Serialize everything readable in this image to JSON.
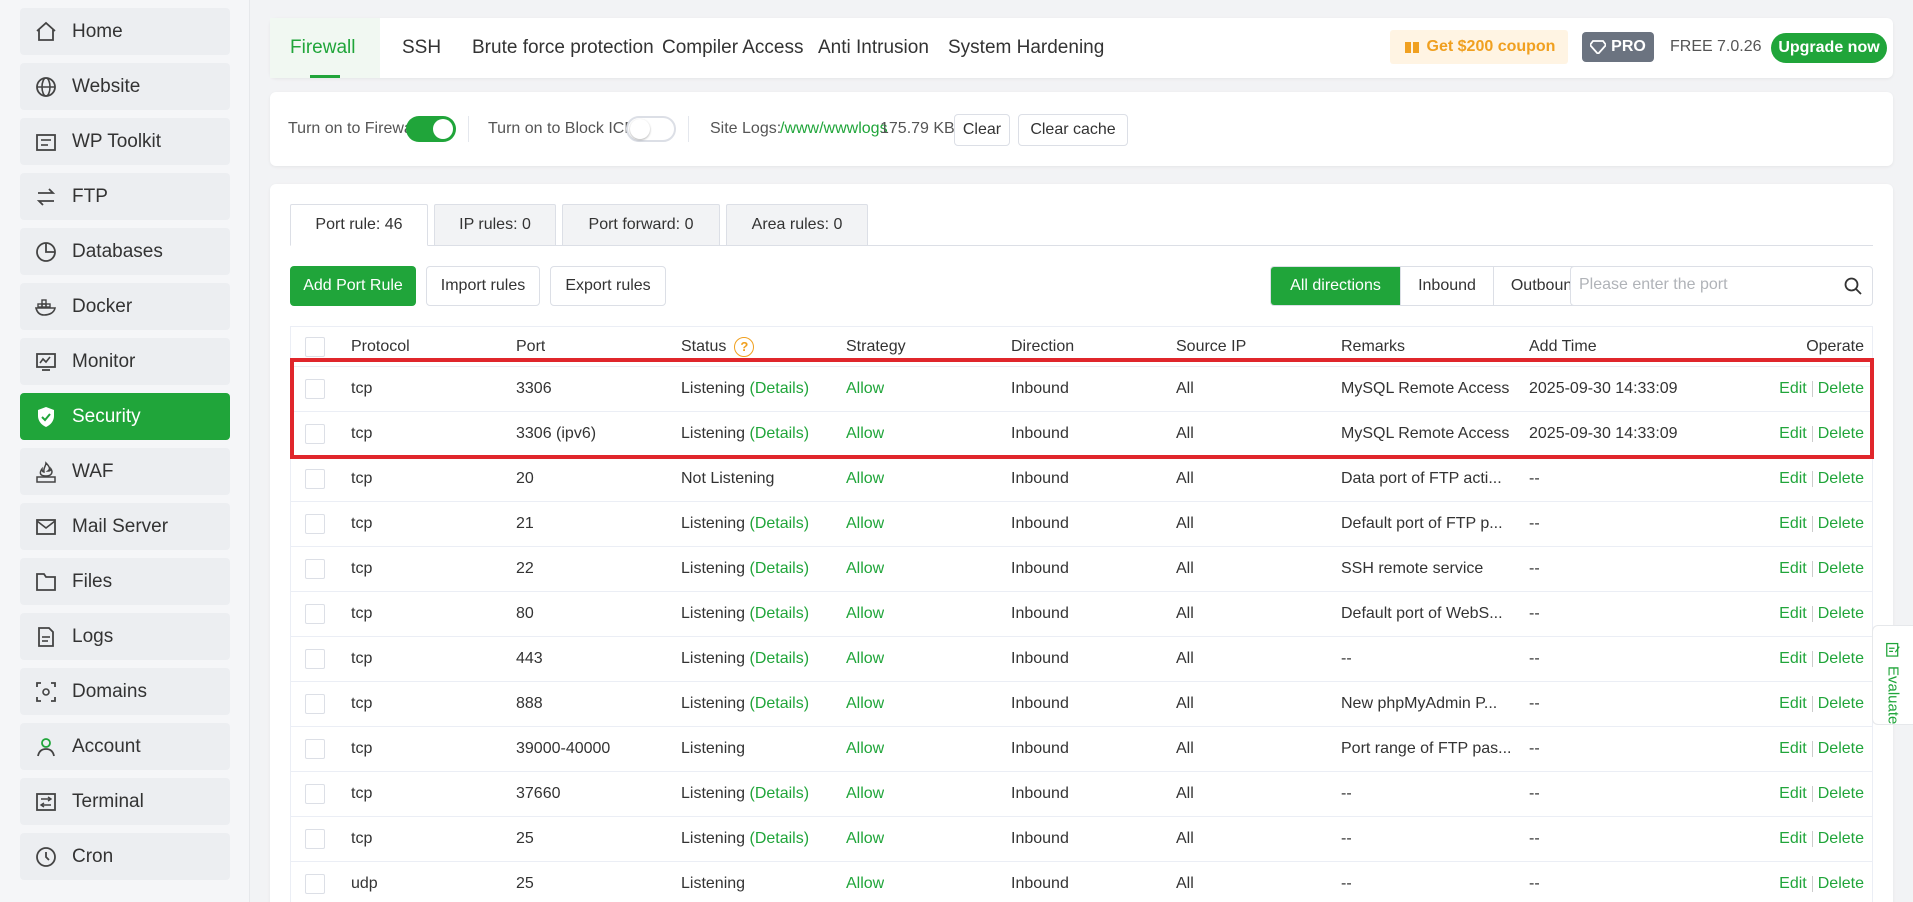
{
  "sidebar": {
    "items": [
      {
        "label": "Home",
        "icon": "home-icon"
      },
      {
        "label": "Website",
        "icon": "globe-icon"
      },
      {
        "label": "WP Toolkit",
        "icon": "toolkit-icon"
      },
      {
        "label": "FTP",
        "icon": "transfer-icon"
      },
      {
        "label": "Databases",
        "icon": "database-icon"
      },
      {
        "label": "Docker",
        "icon": "docker-icon"
      },
      {
        "label": "Monitor",
        "icon": "monitor-icon"
      },
      {
        "label": "Security",
        "icon": "shield-icon",
        "active": true
      },
      {
        "label": "WAF",
        "icon": "waf-icon"
      },
      {
        "label": "Mail Server",
        "icon": "mail-icon"
      },
      {
        "label": "Files",
        "icon": "folder-icon"
      },
      {
        "label": "Logs",
        "icon": "log-icon"
      },
      {
        "label": "Domains",
        "icon": "domain-icon"
      },
      {
        "label": "Account",
        "icon": "user-icon"
      },
      {
        "label": "Terminal",
        "icon": "terminal-icon"
      },
      {
        "label": "Cron",
        "icon": "clock-icon"
      }
    ]
  },
  "header": {
    "tabs": [
      {
        "label": "Firewall",
        "active": true
      },
      {
        "label": "SSH"
      },
      {
        "label": "Brute force protection"
      },
      {
        "label": "Compiler Access"
      },
      {
        "label": "Anti Intrusion"
      },
      {
        "label": "System Hardening"
      }
    ],
    "coupon": "Get $200 coupon",
    "pro": "PRO",
    "free": "FREE",
    "version": "7.0.26",
    "upgrade": "Upgrade now"
  },
  "controls": {
    "firewall_label": "Turn on to Firewall",
    "firewall_on": true,
    "icmp_label": "Turn on to Block ICMP",
    "icmp_on": false,
    "site_logs_label": "Site Logs:",
    "site_logs_path": "/www/wwwlogs",
    "site_logs_size": "175.79 KB",
    "clear": "Clear",
    "clear_cache": "Clear cache"
  },
  "subtabs": [
    {
      "label": "Port rule: 46",
      "active": true
    },
    {
      "label": "IP rules: 0"
    },
    {
      "label": "Port forward: 0"
    },
    {
      "label": "Area rules: 0"
    }
  ],
  "actions": {
    "add": "Add Port Rule",
    "import": "Import rules",
    "export": "Export rules"
  },
  "directions": [
    {
      "label": "All directions",
      "active": true
    },
    {
      "label": "Inbound"
    },
    {
      "label": "Outbound"
    }
  ],
  "search": {
    "placeholder": "Please enter the port"
  },
  "table": {
    "headers": {
      "protocol": "Protocol",
      "port": "Port",
      "status": "Status",
      "strategy": "Strategy",
      "direction": "Direction",
      "source": "Source IP",
      "remarks": "Remarks",
      "time": "Add Time",
      "operate": "Operate"
    },
    "details_text": "(Details)",
    "edit": "Edit",
    "delete": "Delete",
    "rows": [
      {
        "protocol": "tcp",
        "port": "3306",
        "status": "Listening",
        "details": true,
        "strategy": "Allow",
        "direction": "Inbound",
        "source": "All",
        "remarks": "MySQL Remote Access",
        "time": "2025-09-30 14:33:09"
      },
      {
        "protocol": "tcp",
        "port": "3306 (ipv6)",
        "status": "Listening",
        "details": true,
        "strategy": "Allow",
        "direction": "Inbound",
        "source": "All",
        "remarks": "MySQL Remote Access",
        "time": "2025-09-30 14:33:09"
      },
      {
        "protocol": "tcp",
        "port": "20",
        "status": "Not Listening",
        "details": false,
        "strategy": "Allow",
        "direction": "Inbound",
        "source": "All",
        "remarks": "Data port of FTP acti...",
        "time": "--"
      },
      {
        "protocol": "tcp",
        "port": "21",
        "status": "Listening",
        "details": true,
        "strategy": "Allow",
        "direction": "Inbound",
        "source": "All",
        "remarks": "Default port of FTP p...",
        "time": "--"
      },
      {
        "protocol": "tcp",
        "port": "22",
        "status": "Listening",
        "details": true,
        "strategy": "Allow",
        "direction": "Inbound",
        "source": "All",
        "remarks": "SSH remote service",
        "time": "--"
      },
      {
        "protocol": "tcp",
        "port": "80",
        "status": "Listening",
        "details": true,
        "strategy": "Allow",
        "direction": "Inbound",
        "source": "All",
        "remarks": "Default port of WebS...",
        "time": "--"
      },
      {
        "protocol": "tcp",
        "port": "443",
        "status": "Listening",
        "details": true,
        "strategy": "Allow",
        "direction": "Inbound",
        "source": "All",
        "remarks": "--",
        "time": "--"
      },
      {
        "protocol": "tcp",
        "port": "888",
        "status": "Listening",
        "details": true,
        "strategy": "Allow",
        "direction": "Inbound",
        "source": "All",
        "remarks": "New phpMyAdmin P...",
        "time": "--"
      },
      {
        "protocol": "tcp",
        "port": "39000-40000",
        "status": "Listening",
        "details": false,
        "strategy": "Allow",
        "direction": "Inbound",
        "source": "All",
        "remarks": "Port range of FTP pas...",
        "time": "--"
      },
      {
        "protocol": "tcp",
        "port": "37660",
        "status": "Listening",
        "details": true,
        "strategy": "Allow",
        "direction": "Inbound",
        "source": "All",
        "remarks": "--",
        "time": "--"
      },
      {
        "protocol": "tcp",
        "port": "25",
        "status": "Listening",
        "details": true,
        "strategy": "Allow",
        "direction": "Inbound",
        "source": "All",
        "remarks": "--",
        "time": "--"
      },
      {
        "protocol": "udp",
        "port": "25",
        "status": "Listening",
        "details": false,
        "strategy": "Allow",
        "direction": "Inbound",
        "source": "All",
        "remarks": "--",
        "time": "--"
      }
    ]
  },
  "evaluate": "Evaluate",
  "colors": {
    "accent": "#20a53a",
    "highlight": "#e0262b",
    "coupon": "#f0a020"
  }
}
